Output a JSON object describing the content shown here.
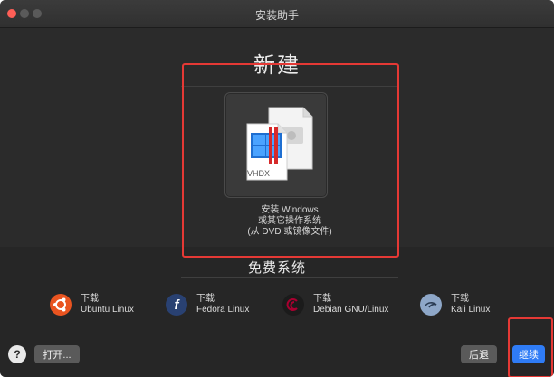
{
  "window": {
    "title": "安装助手"
  },
  "new_section": {
    "title": "新建",
    "install_card": {
      "icon_label": "VHDX",
      "line1": "安装 Windows",
      "line2": "或其它操作系统",
      "line3": "(从 DVD 或镜像文件)"
    }
  },
  "free_section": {
    "title": "免费系统",
    "items": [
      {
        "top": "下载",
        "bottom": "Ubuntu Linux",
        "icon": "ubuntu-icon"
      },
      {
        "top": "下载",
        "bottom": "Fedora Linux",
        "icon": "fedora-icon"
      },
      {
        "top": "下载",
        "bottom": "Debian GNU/Linux",
        "icon": "debian-icon"
      },
      {
        "top": "下载",
        "bottom": "Kali Linux",
        "icon": "kali-icon"
      }
    ]
  },
  "footer": {
    "help": "?",
    "open": "打开...",
    "back": "后退",
    "continue": "继续"
  },
  "colors": {
    "accent": "#2f7cf6",
    "annotation": "#e53935",
    "ubuntu": "#e95420",
    "fedora": "#294172",
    "debian": "#a80030",
    "kali": "#367bf0"
  }
}
